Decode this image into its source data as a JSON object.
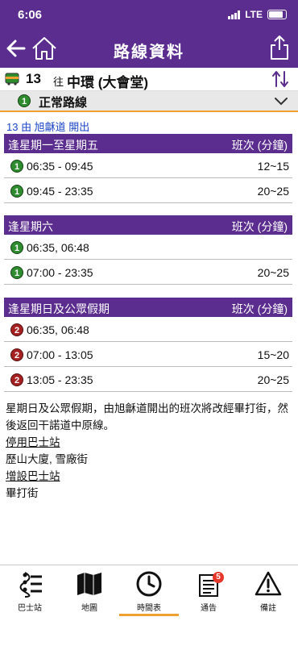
{
  "status": {
    "time": "6:06",
    "network": "LTE"
  },
  "nav": {
    "title": "路線資料"
  },
  "route": {
    "number": "13",
    "direction": "往",
    "destination": "中環 (大會堂)"
  },
  "variant": {
    "badge": "1",
    "label": "正常路線"
  },
  "origin_text": "13 由 旭龢道 開出",
  "sections": [
    {
      "title": "逢星期一至星期五",
      "freq_header": "班次 (分鐘)",
      "rows": [
        {
          "badge": "1",
          "time": "06:35 - 09:45",
          "freq": "12~15"
        },
        {
          "badge": "1",
          "time": "09:45 - 23:35",
          "freq": "20~25"
        }
      ]
    },
    {
      "title": "逢星期六",
      "freq_header": "班次 (分鐘)",
      "rows": [
        {
          "badge": "1",
          "time": "06:35, 06:48",
          "freq": ""
        },
        {
          "badge": "1",
          "time": "07:00 - 23:35",
          "freq": "20~25"
        }
      ]
    },
    {
      "title": "逢星期日及公眾假期",
      "freq_header": "班次 (分鐘)",
      "rows": [
        {
          "badge": "2",
          "time": "06:35, 06:48",
          "freq": ""
        },
        {
          "badge": "2",
          "time": "07:00 - 13:05",
          "freq": "15~20"
        },
        {
          "badge": "2",
          "time": "13:05 - 23:35",
          "freq": "20~25"
        }
      ]
    }
  ],
  "notes": {
    "paragraph": "星期日及公眾假期，由旭龢道開出的班次將改經畢打街，然後返回干諾道中原線。",
    "suspended_heading": "停用巴士站",
    "suspended_stops": "歷山大廈, 雪廠街",
    "added_heading": "增設巴士站",
    "added_stops": "畢打街"
  },
  "tabs": [
    {
      "label": "巴士站",
      "icon": "bus-stop-icon"
    },
    {
      "label": "地圖",
      "icon": "map-icon"
    },
    {
      "label": "時間表",
      "icon": "clock-icon"
    },
    {
      "label": "通告",
      "icon": "notice-icon",
      "badge": "5"
    },
    {
      "label": "備註",
      "icon": "warning-icon"
    }
  ],
  "colors": {
    "header": "#5b2d8e",
    "accent": "#f0a030",
    "badge_green": "#2e8b2e",
    "badge_red": "#a52020",
    "link_blue": "#1c46c8"
  }
}
